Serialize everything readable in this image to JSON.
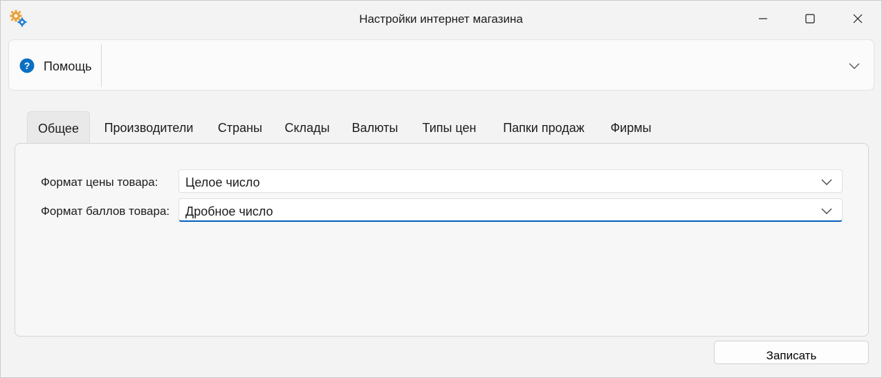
{
  "window": {
    "title": "Настройки интернет магазина",
    "icon": "gears-icon"
  },
  "help": {
    "label": "Помощь",
    "icon": "question-circle-icon"
  },
  "tabs": [
    {
      "label": "Общее",
      "active": true
    },
    {
      "label": "Производители",
      "active": false
    },
    {
      "label": "Страны",
      "active": false
    },
    {
      "label": "Склады",
      "active": false
    },
    {
      "label": "Валюты",
      "active": false
    },
    {
      "label": "Типы цен",
      "active": false
    },
    {
      "label": "Папки продаж",
      "active": false
    },
    {
      "label": "Фирмы",
      "active": false
    }
  ],
  "form": {
    "price_format": {
      "label": "Формат цены товара:",
      "value": "Целое число"
    },
    "points_format": {
      "label": "Формат баллов товара:",
      "value": "Дробное число"
    }
  },
  "actions": {
    "save_label": "Записать"
  },
  "colors": {
    "accent": "#005fb8",
    "help_icon": "#0a6fc2"
  }
}
